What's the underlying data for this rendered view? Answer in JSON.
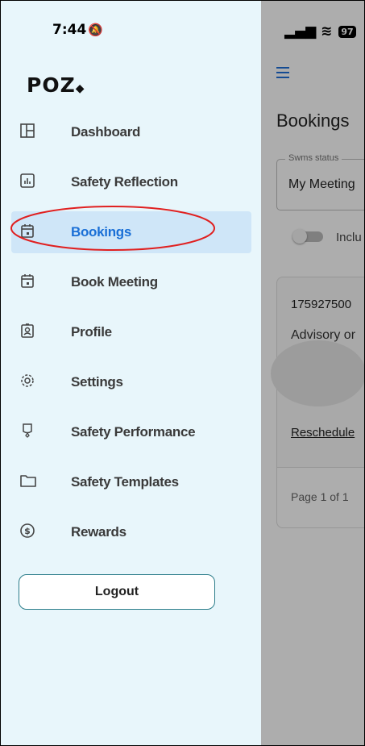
{
  "status_bar": {
    "time": "7:44",
    "battery": "97"
  },
  "logo": "POZ",
  "menu": {
    "items": [
      {
        "id": "dashboard",
        "label": "Dashboard",
        "icon": "dashboard-icon",
        "active": false
      },
      {
        "id": "safety-reflection",
        "label": "Safety Reflection",
        "icon": "bar-chart-icon",
        "active": false
      },
      {
        "id": "bookings",
        "label": "Bookings",
        "icon": "calendar-icon",
        "active": true
      },
      {
        "id": "book-meeting",
        "label": "Book Meeting",
        "icon": "calendar-icon",
        "active": false
      },
      {
        "id": "profile",
        "label": "Profile",
        "icon": "profile-badge-icon",
        "active": false
      },
      {
        "id": "settings",
        "label": "Settings",
        "icon": "gear-icon",
        "active": false
      },
      {
        "id": "safety-performance",
        "label": "Safety Performance",
        "icon": "award-icon",
        "active": false
      },
      {
        "id": "safety-templates",
        "label": "Safety Templates",
        "icon": "folder-icon",
        "active": false
      },
      {
        "id": "rewards",
        "label": "Rewards",
        "icon": "dollar-coin-icon",
        "active": false
      }
    ],
    "logout_label": "Logout"
  },
  "background": {
    "page_title": "Bookings",
    "swms_status": {
      "label": "Swms status",
      "value": "My Meeting"
    },
    "toggle_label": "Inclu",
    "card": {
      "id": "175927500",
      "subtitle": "Advisory or",
      "action": "Reschedule"
    },
    "pagination": "Page 1 of 1"
  },
  "colors": {
    "drawer_bg": "#e8f6fb",
    "active_bg": "#cfe6f8",
    "active_text": "#1a6fd6",
    "annotation": "#e02020"
  }
}
